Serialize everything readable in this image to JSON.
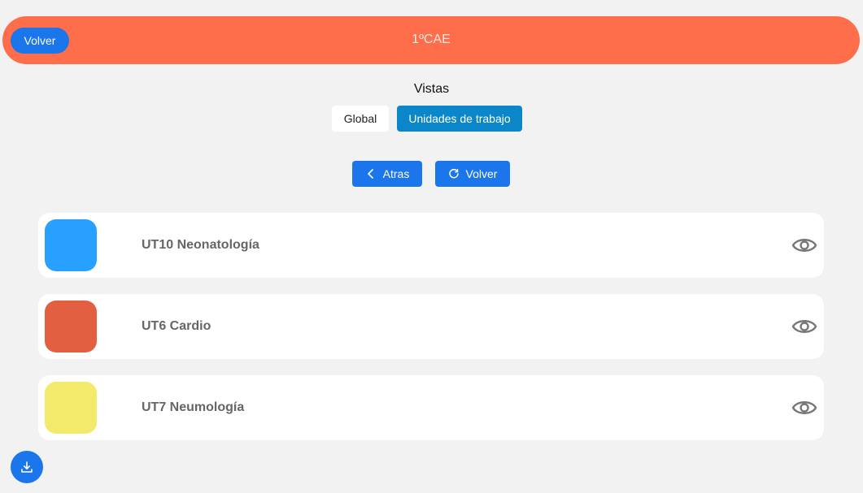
{
  "header": {
    "back_label": "Volver",
    "title": "1ºCAE",
    "color": "#ff6e4a"
  },
  "views": {
    "label": "Vistas",
    "global_label": "Global",
    "unidades_label": "Unidades de trabajo",
    "active": "unidades"
  },
  "nav": {
    "atras_label": "Atras",
    "atras_icon": "chevron-left-icon",
    "volver_label": "Volver",
    "volver_icon": "refresh-icon"
  },
  "units": [
    {
      "title": "UT10 Neonatología",
      "color": "#28a0ff",
      "action_icon": "eye-icon"
    },
    {
      "title": "UT6 Cardio",
      "color": "#e35f42",
      "action_icon": "eye-icon"
    },
    {
      "title": "UT7 Neumología",
      "color": "#f3e96b",
      "action_icon": "eye-icon"
    }
  ],
  "fab": {
    "icon": "download-icon"
  }
}
